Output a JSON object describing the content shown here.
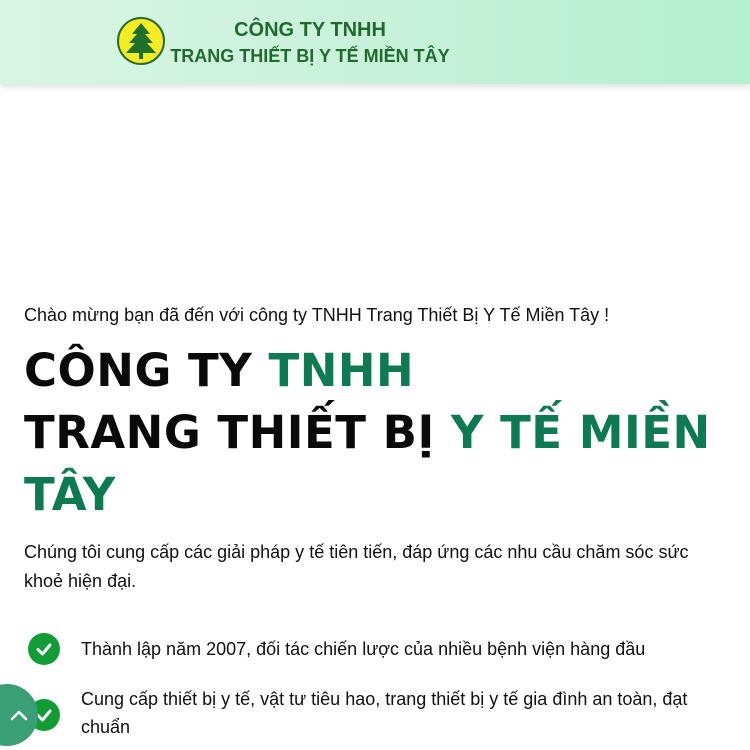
{
  "header": {
    "logo_icon": "pine-tree-icon",
    "brand_line1": "CÔNG TY TNHH",
    "brand_line2": "TRANG THIẾT BỊ Y TẾ MIỀN TÂY"
  },
  "hero": {
    "welcome": "Chào mừng bạn đã đến với công ty TNHH Trang Thiết Bị Y Tế Miền Tây !",
    "headline": {
      "part1": "CÔNG TY ",
      "part1_accent": "TNHH",
      "part2": "TRANG THIẾT BỊ ",
      "part2_accent": "Y TẾ MIỀN TÂY"
    },
    "description": "Chúng tôi cung cấp các giải pháp y tế tiên tiến, đáp ứng các nhu cầu chăm sóc sức khoẻ hiện đại.",
    "features": [
      {
        "icon": "check-circle-icon",
        "text": "Thành lập năm 2007, đối tác chiến lược của nhiều bệnh viện hàng đầu"
      },
      {
        "icon": "check-circle-icon",
        "text": "Cung cấp thiết bị y tế, vật tư tiêu hao, trang thiết bị y tế gia đình an toàn, đạt chuẩn"
      }
    ]
  },
  "scroll_top": {
    "icon": "chevron-up-icon"
  },
  "colors": {
    "accent": "#0e7a52",
    "header_bg": "#c8f1d9",
    "brand_text": "#1f6b2e",
    "check_green": "#129c36",
    "scroll_button": "#3a9f77"
  }
}
